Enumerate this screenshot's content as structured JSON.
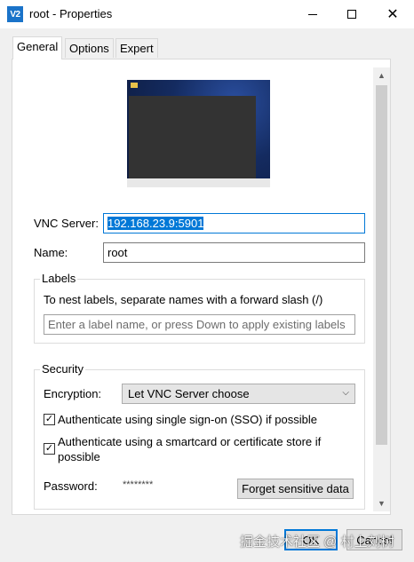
{
  "window": {
    "icon_text": "V2",
    "title": "root - Properties"
  },
  "tabs": [
    {
      "label": "General",
      "active": true
    },
    {
      "label": "Options",
      "active": false
    },
    {
      "label": "Expert",
      "active": false
    }
  ],
  "general": {
    "vnc_server_label": "VNC Server:",
    "vnc_server_value": "192.168.23.9:5901",
    "name_label": "Name:",
    "name_value": "root",
    "labels_group": {
      "title": "Labels",
      "hint": "To nest labels, separate names with a forward slash (/)",
      "placeholder": "Enter a label name, or press Down to apply existing labels"
    },
    "security_group": {
      "title": "Security",
      "encryption_label": "Encryption:",
      "encryption_value": "Let VNC Server choose",
      "sso_label": "Authenticate using single sign-on (SSO) if possible",
      "sso_checked": true,
      "smartcard_label_line1": "Authenticate using a smartcard or certificate store if",
      "smartcard_label_line2": "possible",
      "smartcard_checked": true,
      "password_label": "Password:",
      "password_value": "********",
      "forget_button": "Forget sensitive data"
    }
  },
  "footer": {
    "ok_button": "OK",
    "cancel_button": "Cancel"
  },
  "watermark": "掘金技术社区 @ 村上刘树",
  "colors": {
    "accent": "#0078d7",
    "app_icon": "#1a73c9"
  }
}
